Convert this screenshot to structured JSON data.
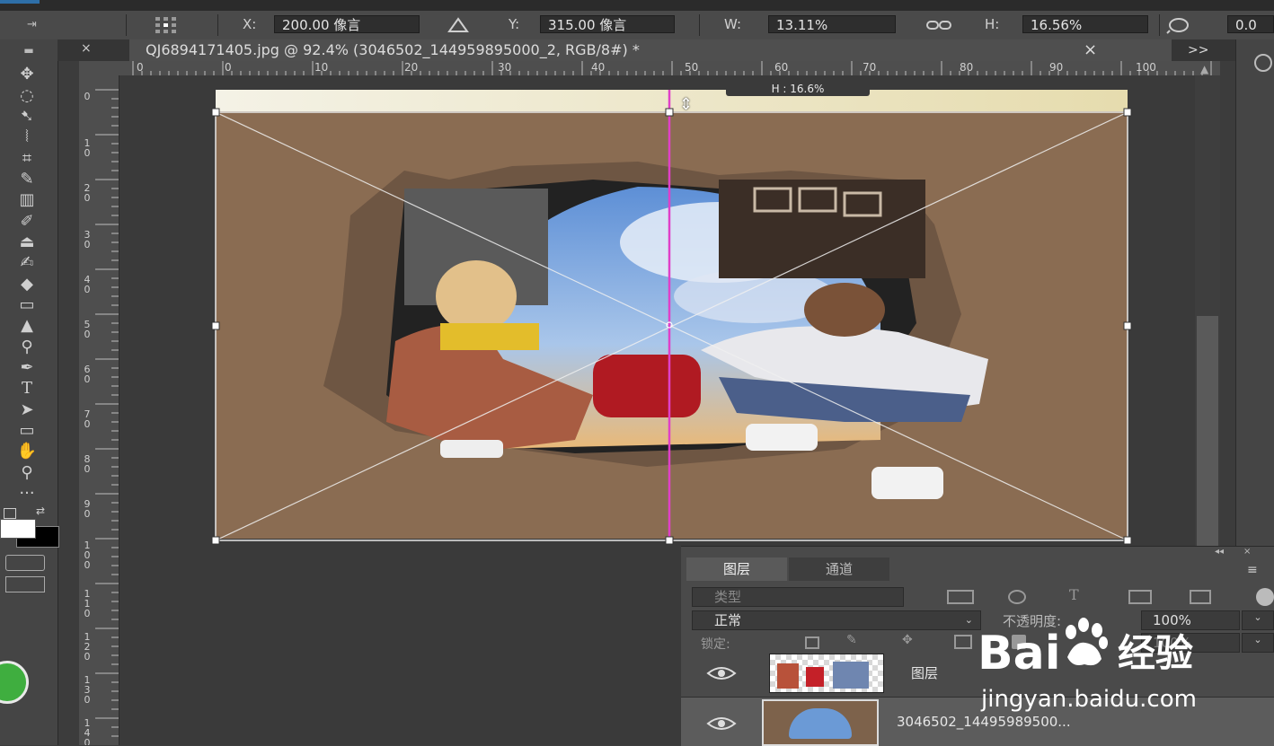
{
  "options_bar": {
    "x_label": "X:",
    "x_value": "200.00 像言",
    "y_label": "Y:",
    "y_value": "315.00 像言",
    "w_label": "W:",
    "w_value": "13.11%",
    "h_label": "H:",
    "h_value": "16.56%",
    "right_value": "0.0"
  },
  "document_tab": {
    "title": "QJ6894171405.jpg @ 92.4% (3046502_144959895000_2, RGB/8#) *",
    "close": "×",
    "overflow": ">>"
  },
  "ruler": {
    "horizontal": [
      "0",
      "0",
      "10",
      "20",
      "30",
      "40",
      "50",
      "60",
      "70",
      "80",
      "90",
      "100"
    ],
    "vertical": [
      "0",
      "1 0",
      "2 0",
      "3 0",
      "4 0",
      "5 0",
      "6 0",
      "7 0",
      "8 0",
      "9 0",
      "1 0 0",
      "1 1 0",
      "1 2 0",
      "1 3 0",
      "1 4 0"
    ]
  },
  "canvas": {
    "transform_tooltip": "H : 16.6%"
  },
  "layers_panel": {
    "tabs": [
      "图层",
      "通道"
    ],
    "filter_kind": "类型",
    "blend_mode": "正常",
    "opacity_label": "不透明度:",
    "opacity_value": "100%",
    "lock_label": "锁定:",
    "fill_value": "100%",
    "layers": [
      {
        "name": "图层"
      },
      {
        "name": "3046502_14495989500..."
      }
    ]
  },
  "watermark": {
    "brand": "Bai",
    "brand_cn": "经验",
    "url": "jingyan.baidu.com"
  },
  "colors": {
    "guide": "#e040c8",
    "accent": "#3fae3f"
  }
}
